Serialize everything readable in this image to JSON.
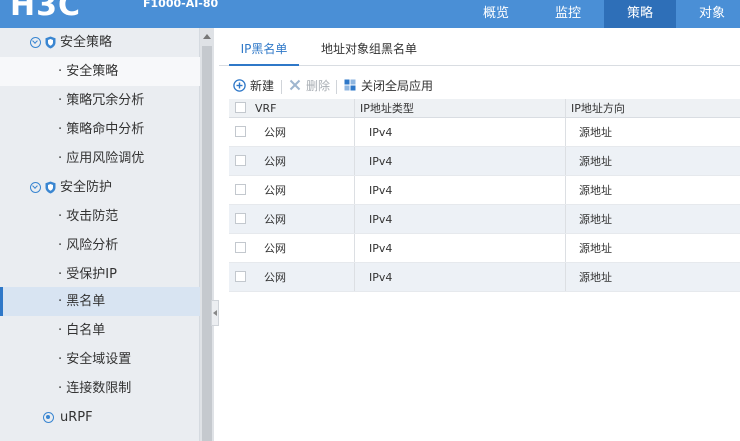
{
  "header": {
    "logo_text": "H3C",
    "model": "F1000-AI-80",
    "nav": [
      {
        "label": "概览",
        "active": false
      },
      {
        "label": "监控",
        "active": false
      },
      {
        "label": "策略",
        "active": true
      },
      {
        "label": "对象",
        "active": false
      }
    ]
  },
  "sidebar": {
    "items": [
      {
        "label": "安全策略",
        "type": "group",
        "icon": "shield-icon"
      },
      {
        "label": "安全策略",
        "type": "child"
      },
      {
        "label": "策略冗余分析",
        "type": "child"
      },
      {
        "label": "策略命中分析",
        "type": "child"
      },
      {
        "label": "应用风险调优",
        "type": "child"
      },
      {
        "label": "安全防护",
        "type": "group",
        "icon": "shield-icon"
      },
      {
        "label": "攻击防范",
        "type": "child"
      },
      {
        "label": "风险分析",
        "type": "child"
      },
      {
        "label": "受保护IP",
        "type": "child"
      },
      {
        "label": "黑名单",
        "type": "child",
        "selected": true
      },
      {
        "label": "白名单",
        "type": "child"
      },
      {
        "label": "安全域设置",
        "type": "child"
      },
      {
        "label": "连接数限制",
        "type": "child"
      },
      {
        "label": "uRPF",
        "type": "group",
        "icon": "dot-circle-icon"
      }
    ]
  },
  "tabs": [
    {
      "label": "IP黑名单",
      "active": true
    },
    {
      "label": "地址对象组黑名单",
      "active": false
    }
  ],
  "toolbar": {
    "new_label": "新建",
    "delete_label": "删除",
    "disable_all_label": "关闭全局应用"
  },
  "table": {
    "columns": [
      "VRF",
      "IP地址类型",
      "IP地址方向"
    ],
    "rows": [
      {
        "vrf": "公网",
        "ip_type": "IPv4",
        "direction": "源地址"
      },
      {
        "vrf": "公网",
        "ip_type": "IPv4",
        "direction": "源地址"
      },
      {
        "vrf": "公网",
        "ip_type": "IPv4",
        "direction": "源地址"
      },
      {
        "vrf": "公网",
        "ip_type": "IPv4",
        "direction": "源地址"
      },
      {
        "vrf": "公网",
        "ip_type": "IPv4",
        "direction": "源地址"
      },
      {
        "vrf": "公网",
        "ip_type": "IPv4",
        "direction": "源地址"
      }
    ]
  },
  "colors": {
    "header_bg": "#4a8fd6",
    "header_active": "#2e6fb8",
    "accent": "#2f78c8",
    "sidebar_bg": "#eaedf1"
  }
}
